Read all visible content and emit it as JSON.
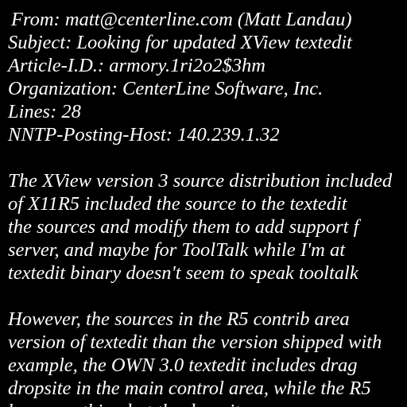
{
  "header": {
    "from": "From: matt@centerline.com (Matt Landau)",
    "subject": "Subject: Looking for updated XView textedit",
    "article_id": "Article-I.D.: armory.1ri2o2$3hm",
    "organization": "Organization: CenterLine Software, Inc.",
    "lines": "Lines: 28",
    "nntp_posting_host": "NNTP-Posting-Host: 140.239.1.32"
  },
  "body": {
    "paragraph1": [
      "The XView version 3 source distribution included",
      "of X11R5 included the source to the textedit",
      "the sources and modify them to add support f",
      "server, and maybe for ToolTalk while I'm at",
      "textedit binary doesn't seem to speak tooltalk"
    ],
    "paragraph2": [
      "However, the sources in the R5 contrib area",
      "version of textedit than the version shipped with",
      "example, the OWN 3.0 textedit includes drag",
      "dropsite in the main control area, while the R5",
      "has everything but the dropsite."
    ]
  }
}
